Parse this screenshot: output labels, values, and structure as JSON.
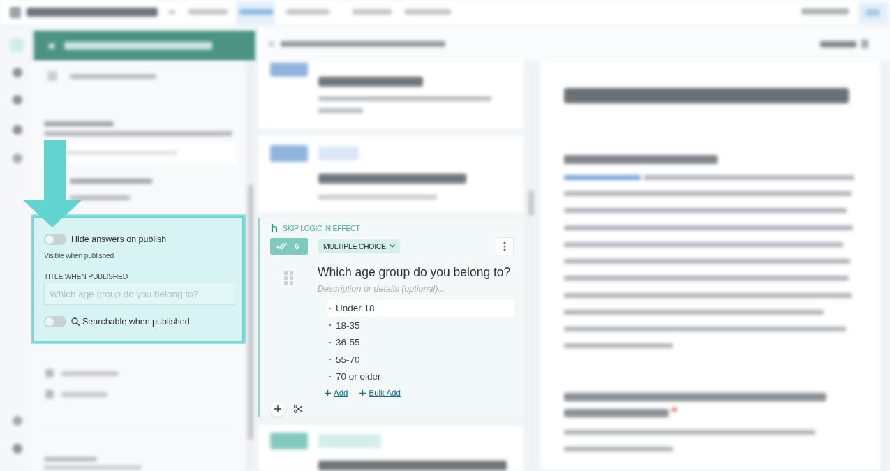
{
  "settings_panel": {
    "hide_answers": {
      "label": "Hide answers on publish",
      "on": false
    },
    "status": "Visible when published",
    "title_field": {
      "label": "TITLE WHEN PUBLISHED",
      "placeholder": "Which age group do you belong to?"
    },
    "searchable": {
      "label": "Searchable when published",
      "on": false
    }
  },
  "question": {
    "skip_logic": "SKIP LOGIC IN EFFECT",
    "count": "6",
    "type": "MULTIPLE CHOICE",
    "title": "Which age group do you belong to?",
    "description": {
      "placeholder": "Description or details (optional)..."
    },
    "options": [
      {
        "label": "Under 18",
        "editing": true
      },
      {
        "label": "18-35",
        "editing": false
      },
      {
        "label": "36-55",
        "editing": false
      },
      {
        "label": "55-70",
        "editing": false
      },
      {
        "label": "70 or older",
        "editing": false
      }
    ],
    "actions": [
      {
        "label": "Add"
      },
      {
        "label": "Bulk Add"
      }
    ]
  }
}
